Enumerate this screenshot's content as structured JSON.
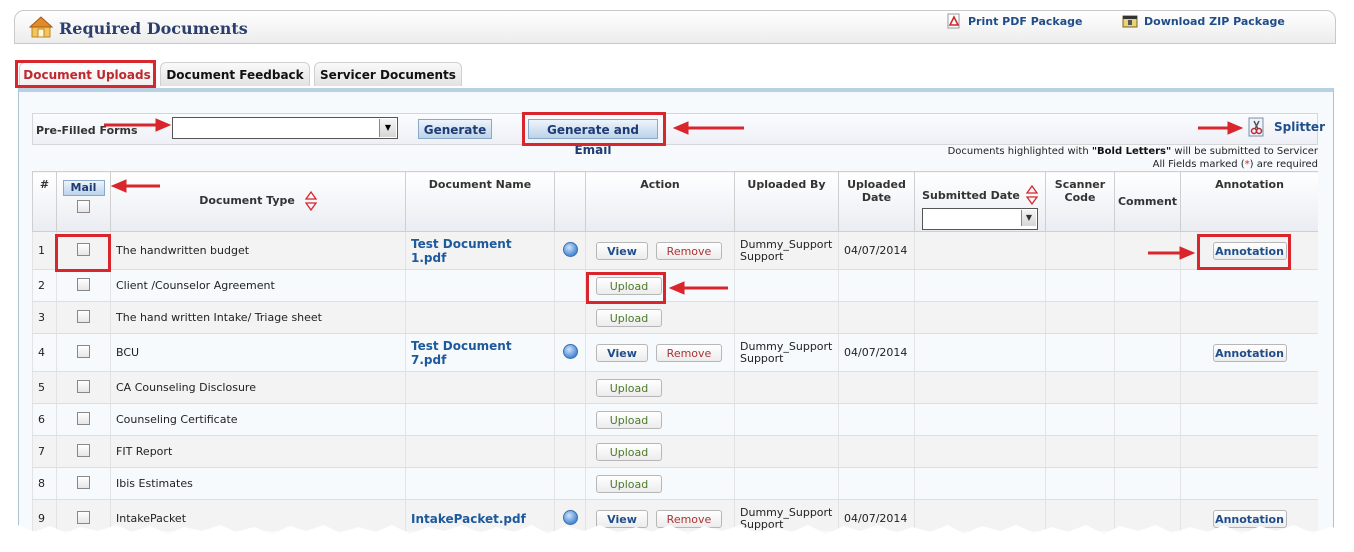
{
  "header": {
    "title": "Required Documents",
    "print_pdf": "Print PDF Package",
    "download_zip": "Download ZIP Package"
  },
  "tabs": [
    {
      "label": "Document Uploads",
      "active": true
    },
    {
      "label": "Document Feedback",
      "active": false
    },
    {
      "label": "Servicer Documents",
      "active": false
    }
  ],
  "prefilled": {
    "label": "Pre-Filled Forms",
    "select_value": "",
    "generate": "Generate",
    "generate_email": "Generate and Email",
    "splitter": "Splitter"
  },
  "notes": {
    "line1_pre": "Documents highlighted with ",
    "line1_bold": "\"Bold Letters\"",
    "line1_post": " will be submitted to Servicer",
    "line2_pre": "All Fields marked (",
    "line2_star": "*",
    "line2_post": ") are required"
  },
  "table": {
    "headers": {
      "num": "#",
      "mail": "Mail",
      "doc_type": "Document Type",
      "doc_name": "Document Name",
      "action": "Action",
      "uploaded_by": "Uploaded By",
      "uploaded_date": "Uploaded Date",
      "submitted_date": "Submitted Date",
      "scanner_code": "Scanner Code",
      "comment": "Comment",
      "annotation": "Annotation"
    },
    "buttons": {
      "view": "View",
      "remove": "Remove",
      "upload": "Upload",
      "annotation": "Annotation"
    },
    "rows": [
      {
        "num": "1",
        "type": "The handwritten budget",
        "name": "Test Document 1.pdf",
        "uploaded_by": "Dummy_Support Support",
        "date": "04/07/2014",
        "has_file": true
      },
      {
        "num": "2",
        "type": "Client /Counselor Agreement",
        "name": "",
        "uploaded_by": "",
        "date": "",
        "has_file": false
      },
      {
        "num": "3",
        "type": "The hand written Intake/ Triage sheet",
        "name": "",
        "uploaded_by": "",
        "date": "",
        "has_file": false
      },
      {
        "num": "4",
        "type": "BCU",
        "name": "Test Document 7.pdf",
        "uploaded_by": "Dummy_Support Support",
        "date": "04/07/2014",
        "has_file": true
      },
      {
        "num": "5",
        "type": "CA Counseling Disclosure",
        "name": "",
        "uploaded_by": "",
        "date": "",
        "has_file": false
      },
      {
        "num": "6",
        "type": "Counseling Certificate",
        "name": "",
        "uploaded_by": "",
        "date": "",
        "has_file": false
      },
      {
        "num": "7",
        "type": "FIT Report",
        "name": "",
        "uploaded_by": "",
        "date": "",
        "has_file": false
      },
      {
        "num": "8",
        "type": "Ibis Estimates",
        "name": "",
        "uploaded_by": "",
        "date": "",
        "has_file": false
      },
      {
        "num": "9",
        "type": "IntakePacket",
        "name": "IntakePacket.pdf",
        "uploaded_by": "Dummy_Support Support",
        "date": "04/07/2014",
        "has_file": true
      }
    ]
  },
  "colors": {
    "highlight": "#d8262c",
    "link": "#1d5a9c",
    "title": "#2c3e6b"
  },
  "icons": [
    "home-upload-icon",
    "pdf-icon",
    "zip-icon",
    "scissors-icon",
    "sort-icon",
    "radio-dot-icon"
  ]
}
